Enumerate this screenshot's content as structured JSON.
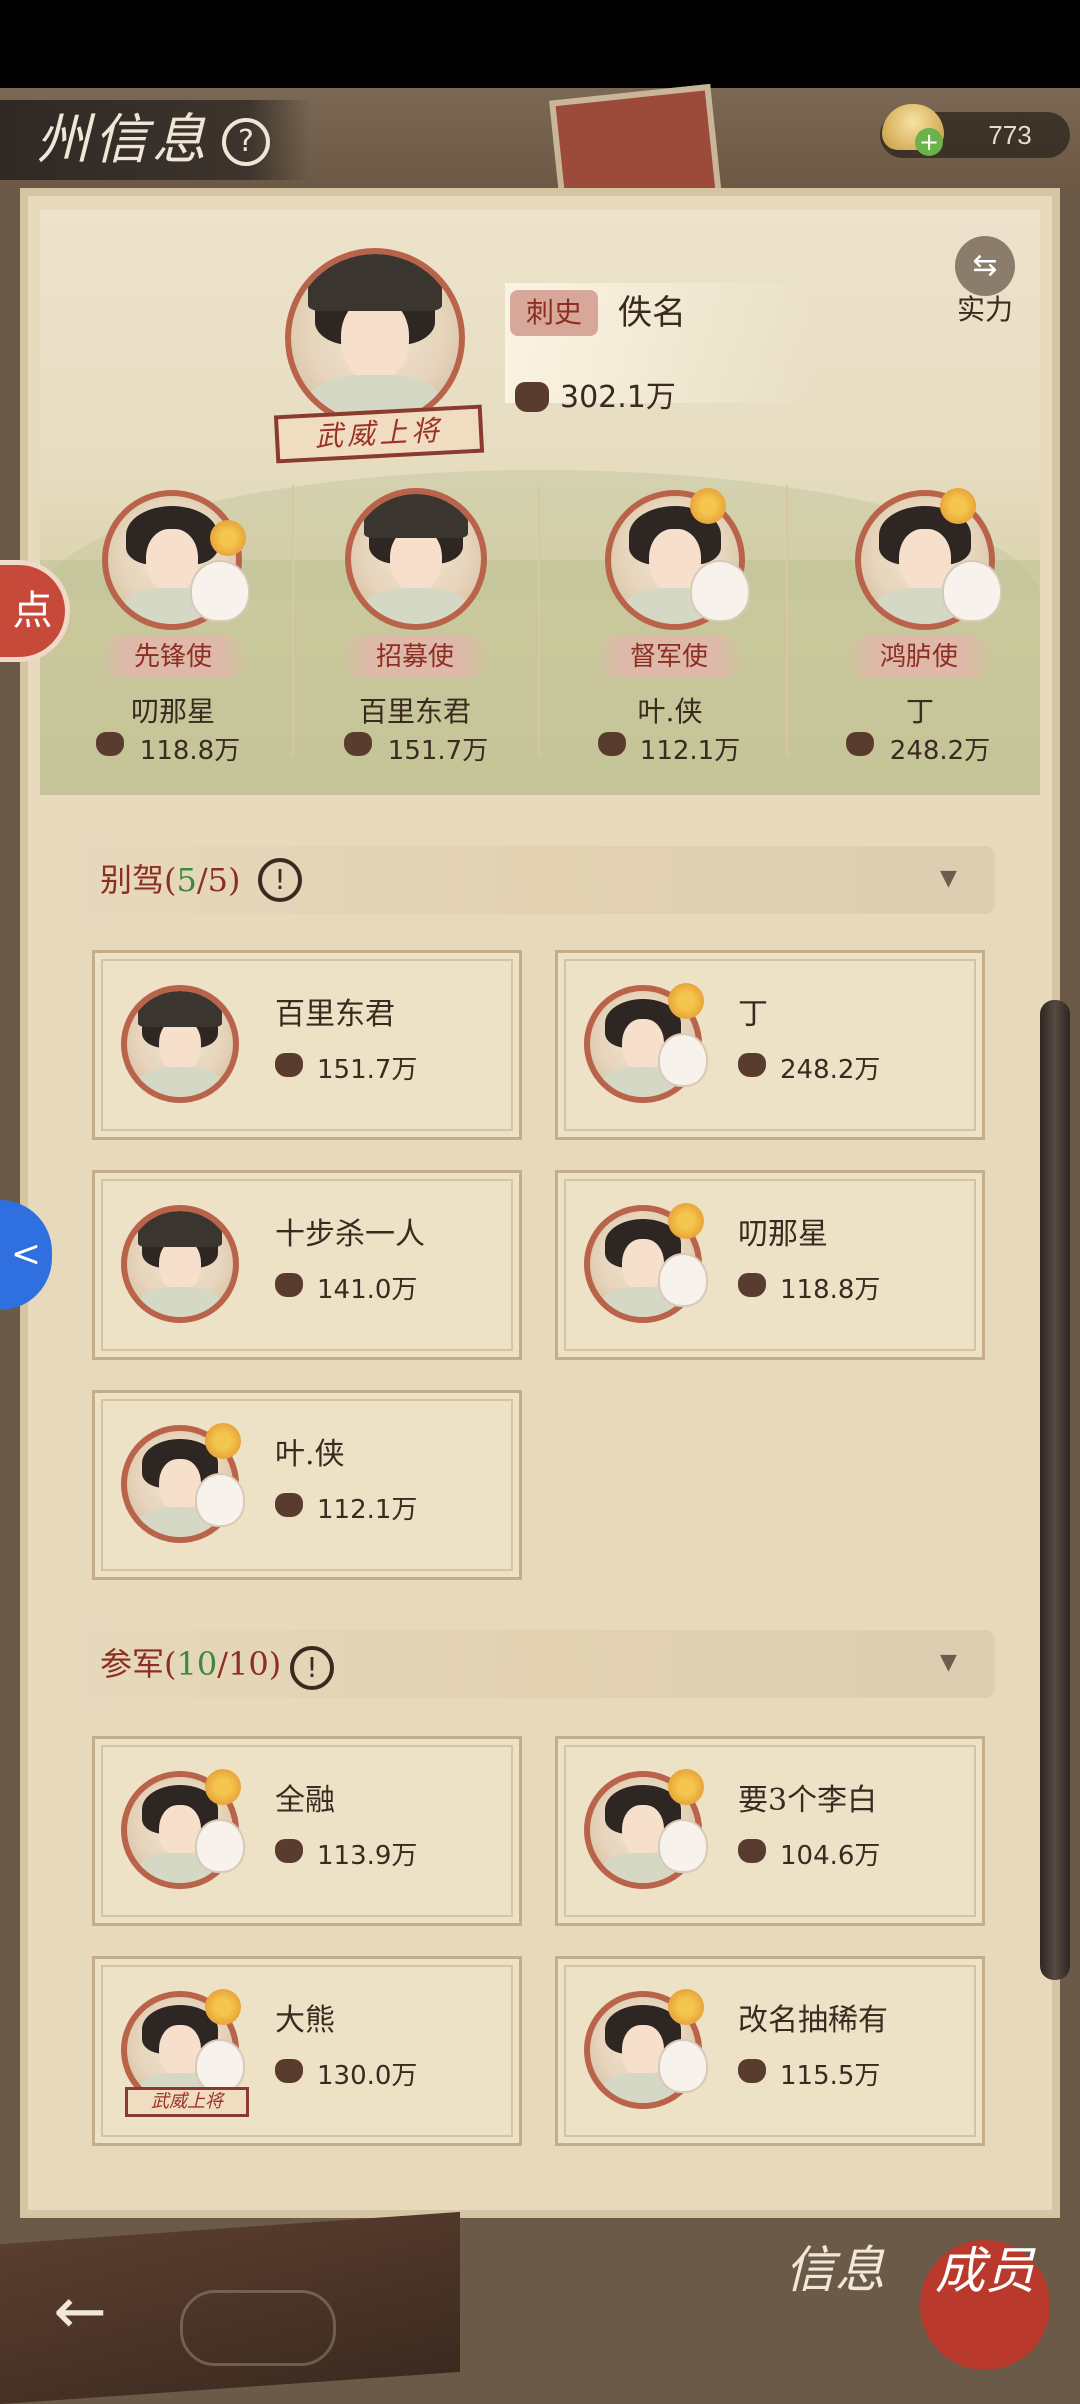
{
  "header": {
    "title": "州信息",
    "help_icon": "?",
    "currency_value": "773"
  },
  "chief": {
    "badge": "武威上将",
    "role": "刺史",
    "name": "佚名",
    "power": "302.1万"
  },
  "switch": {
    "icon": "⇆",
    "label": "实力"
  },
  "aides": [
    {
      "role": "先锋使",
      "name": "叨那星",
      "power": "118.8万"
    },
    {
      "role": "招募使",
      "name": "百里东君",
      "power": "151.7万"
    },
    {
      "role": "督军使",
      "name": "叶.侠",
      "power": "112.1万"
    },
    {
      "role": "鸿胪使",
      "name": "丁",
      "power": "248.2万"
    }
  ],
  "side_buttons": {
    "dot_label": "点",
    "blue_icon": "<"
  },
  "biejia": {
    "title": "别驾",
    "count": "5",
    "total": "5",
    "members": [
      {
        "name": "百里东君",
        "power": "151.7万"
      },
      {
        "name": "丁",
        "power": "248.2万"
      },
      {
        "name": "十步杀一人",
        "power": "141.0万"
      },
      {
        "name": "叨那星",
        "power": "118.8万"
      },
      {
        "name": "叶.侠",
        "power": "112.1万"
      }
    ]
  },
  "canjun": {
    "title": "参军",
    "count": "10",
    "total": "10",
    "members": [
      {
        "name": "全融",
        "power": "113.9万"
      },
      {
        "name": "要3个李白",
        "power": "104.6万"
      },
      {
        "name": "大熊",
        "power": "130.0万",
        "badge": "武威上将"
      },
      {
        "name": "改名抽稀有",
        "power": "115.5万"
      }
    ]
  },
  "footer": {
    "back_icon": "←",
    "info_tab": "信息",
    "member_tab": "成员"
  }
}
